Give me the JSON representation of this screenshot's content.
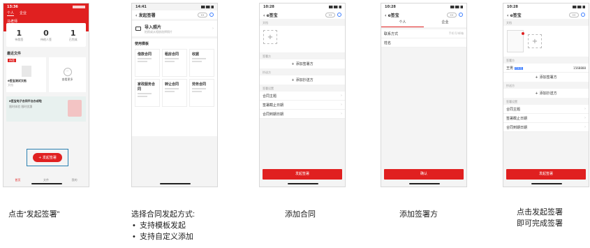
{
  "p1": {
    "time": "13:36",
    "tabs": [
      "个人",
      "企业"
    ],
    "user": "马老师",
    "stats": [
      {
        "num": "1",
        "label": "待我签"
      },
      {
        "num": "0",
        "label": "待他人签"
      },
      {
        "num": "1",
        "label": "已完成"
      }
    ],
    "recent_title": "最近文件",
    "file_badge": "待签",
    "file_name": "e签宝测试文档",
    "file_sub": "文档",
    "more_label": "查看更多",
    "banner_title": "e签宝电子合同平台办成啦",
    "banner_sub": "限时体验  限时优惠",
    "start_button": "发起签署",
    "tabbar": [
      "首页",
      "文件",
      "我的"
    ]
  },
  "p2": {
    "time": "14:41",
    "title": "发起签署",
    "import_title": "导入照片",
    "import_sub": "拍照或从相册选择照片",
    "use_template": "使用模板",
    "templates": [
      "借款合同",
      "租房合同",
      "收据",
      "家政服务合同",
      "转让合同",
      "劳务合同"
    ]
  },
  "p3": {
    "time": "10:28",
    "title": "e签宝",
    "doc_label": "文档",
    "signer_label": "签署方",
    "add_signer": "添加签署方",
    "cc_label": "抄送方",
    "add_cc": "添加抄送方",
    "settings_label": "签署设置",
    "rows": [
      "合同主题",
      "签署截止日期",
      "合同到期日期"
    ],
    "submit": "发起签署"
  },
  "p4": {
    "time": "10:28",
    "title": "e签宝",
    "tabs": [
      "个人",
      "企业"
    ],
    "contact_label": "联系方式",
    "contact_placeholder": "手机号/邮箱",
    "name_label": "姓名",
    "confirm": "确认"
  },
  "p5": {
    "time": "10:28",
    "title": "e签宝",
    "doc_label": "文档",
    "signer_label": "签署方",
    "signer_name": "王男",
    "signer_tag": "已实名",
    "signer_phone": "1568888",
    "add_signer": "添加签署方",
    "cc_label": "抄送方",
    "add_cc": "添加抄送方",
    "settings_label": "签署设置",
    "rows": [
      "合同主题",
      "签署截止日期",
      "合同到期日期"
    ],
    "submit": "发起签署"
  },
  "captions": {
    "c1": "点击“发起签署”",
    "c2_title": "选择合同发起方式:",
    "c2_b1": "支持模板发起",
    "c2_b2": "支持自定义添加",
    "c3": "添加合同",
    "c4": "添加签署方",
    "c5_title": "点击发起签署",
    "c5_sub": "即可完成签署"
  },
  "colors": {
    "accent": "#e02020",
    "link": "#3b7cff"
  }
}
